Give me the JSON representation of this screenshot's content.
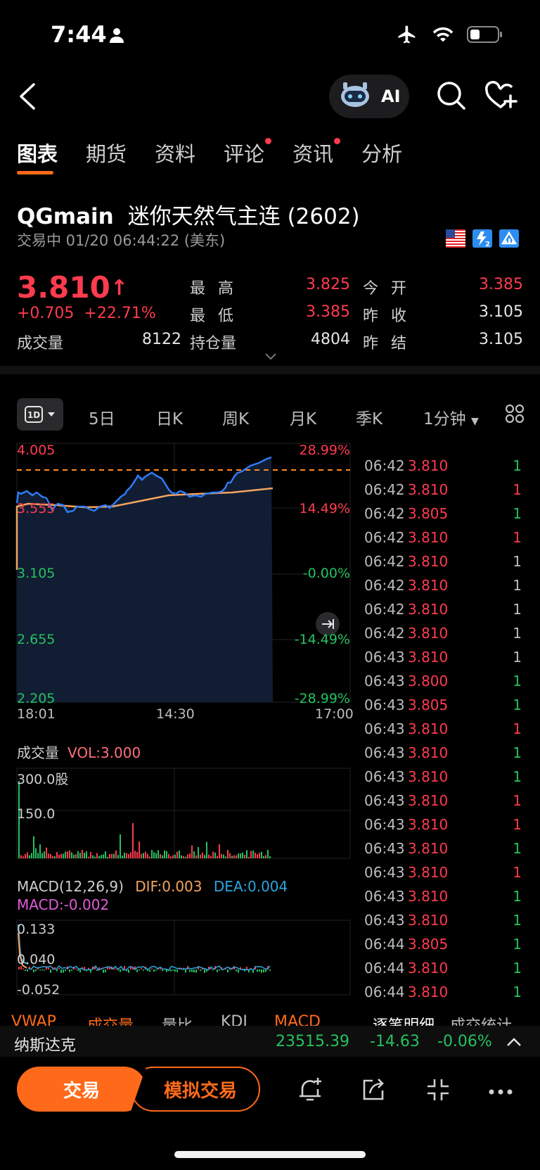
{
  "status": {
    "time": "7:44"
  },
  "nav": {
    "ai_label": "AI"
  },
  "tabs": [
    {
      "label": "图表",
      "active": true,
      "dot": false
    },
    {
      "label": "期货",
      "active": false,
      "dot": false
    },
    {
      "label": "资料",
      "active": false,
      "dot": false
    },
    {
      "label": "评论",
      "active": false,
      "dot": true
    },
    {
      "label": "资讯",
      "active": false,
      "dot": true
    },
    {
      "label": "分析",
      "active": false,
      "dot": false
    }
  ],
  "instrument": {
    "symbol": "QGmain",
    "name": "迷你天然气主连 (2602)",
    "status_line": "交易中 01/20 06:44:22 (美东)",
    "price": "3.810",
    "change": "+0.705",
    "change_pct": "+22.71%",
    "volume_label": "成交量",
    "volume": "8122",
    "quotes": {
      "high_label": "最高",
      "high": "3.825",
      "low_label": "最低",
      "low": "3.385",
      "oi_label": "持仓量",
      "oi": "4804",
      "open_label": "今开",
      "open": "3.385",
      "prev_close_label": "昨收",
      "prev_close": "3.105",
      "prev_settle_label": "昨结",
      "prev_settle": "3.105"
    }
  },
  "periods": {
    "selected": "1D",
    "items": [
      "5日",
      "日K",
      "周K",
      "月K",
      "季K",
      "1分钟"
    ]
  },
  "chart": {
    "y_left": [
      "4.005",
      "3.555",
      "3.105",
      "2.655",
      "2.205"
    ],
    "y_right": [
      "28.99%",
      "14.49%",
      "-0.00%",
      "-14.49%",
      "-28.99%"
    ],
    "x_labels": [
      "18:01",
      "14:30",
      "17:00"
    ],
    "volume_title": "成交量",
    "volume_value": "VOL:3.000",
    "volume_axis": [
      "300.0股",
      "150.0"
    ],
    "macd_title": "MACD(12,26,9)",
    "macd_dif": "DIF:0.003",
    "macd_dea": "DEA:0.004",
    "macd_val": "MACD:-0.002",
    "macd_axis": [
      "0.133",
      "0.040",
      "-0.052"
    ],
    "colors": {
      "line": "#2f7cf6",
      "avg": "#f4a460",
      "up": "#ff3b4e",
      "down": "#25c160"
    }
  },
  "trades": [
    {
      "t": "06:42",
      "p": "3.810",
      "q": "1",
      "pc": "red",
      "qc": "green"
    },
    {
      "t": "06:42",
      "p": "3.810",
      "q": "1",
      "pc": "red",
      "qc": "red"
    },
    {
      "t": "06:42",
      "p": "3.805",
      "q": "1",
      "pc": "red",
      "qc": "green"
    },
    {
      "t": "06:42",
      "p": "3.810",
      "q": "1",
      "pc": "red",
      "qc": "red"
    },
    {
      "t": "06:42",
      "p": "3.810",
      "q": "1",
      "pc": "red",
      "qc": "gray"
    },
    {
      "t": "06:42",
      "p": "3.810",
      "q": "1",
      "pc": "red",
      "qc": "gray"
    },
    {
      "t": "06:42",
      "p": "3.810",
      "q": "1",
      "pc": "red",
      "qc": "gray"
    },
    {
      "t": "06:42",
      "p": "3.810",
      "q": "1",
      "pc": "red",
      "qc": "gray"
    },
    {
      "t": "06:43",
      "p": "3.810",
      "q": "1",
      "pc": "red",
      "qc": "gray"
    },
    {
      "t": "06:43",
      "p": "3.800",
      "q": "1",
      "pc": "red",
      "qc": "green"
    },
    {
      "t": "06:43",
      "p": "3.805",
      "q": "1",
      "pc": "red",
      "qc": "green"
    },
    {
      "t": "06:43",
      "p": "3.810",
      "q": "1",
      "pc": "red",
      "qc": "red"
    },
    {
      "t": "06:43",
      "p": "3.810",
      "q": "1",
      "pc": "red",
      "qc": "green"
    },
    {
      "t": "06:43",
      "p": "3.810",
      "q": "1",
      "pc": "red",
      "qc": "green"
    },
    {
      "t": "06:43",
      "p": "3.810",
      "q": "1",
      "pc": "red",
      "qc": "red"
    },
    {
      "t": "06:43",
      "p": "3.810",
      "q": "1",
      "pc": "red",
      "qc": "red"
    },
    {
      "t": "06:43",
      "p": "3.810",
      "q": "1",
      "pc": "red",
      "qc": "green"
    },
    {
      "t": "06:43",
      "p": "3.810",
      "q": "1",
      "pc": "red",
      "qc": "red"
    },
    {
      "t": "06:43",
      "p": "3.810",
      "q": "1",
      "pc": "red",
      "qc": "green"
    },
    {
      "t": "06:43",
      "p": "3.810",
      "q": "1",
      "pc": "red",
      "qc": "green"
    },
    {
      "t": "06:44",
      "p": "3.805",
      "q": "1",
      "pc": "red",
      "qc": "green"
    },
    {
      "t": "06:44",
      "p": "3.810",
      "q": "1",
      "pc": "red",
      "qc": "green"
    },
    {
      "t": "06:44",
      "p": "3.810",
      "q": "1",
      "pc": "red",
      "qc": "green"
    }
  ],
  "bottom_tabs": [
    "VWAP",
    "成交量",
    "量比",
    "KDJ",
    "MACD",
    "逐笔明细",
    "成交统计"
  ],
  "index_bar": {
    "name": "纳斯达克",
    "value": "23515.39",
    "change": "-14.63",
    "pct": "-0.06%"
  },
  "actions": {
    "trade": "交易",
    "sim_trade": "模拟交易"
  }
}
